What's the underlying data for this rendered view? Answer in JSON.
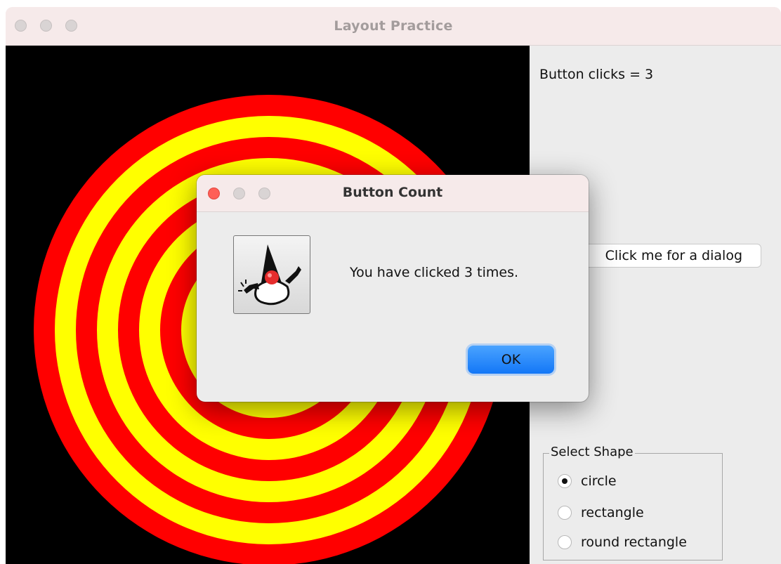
{
  "window": {
    "title": "Layout Practice"
  },
  "canvas": {
    "background": "#000000",
    "ring_colors": [
      "#ff0000",
      "#ffff00"
    ]
  },
  "side_panel": {
    "clicks_text": "Button clicks = 3",
    "dialog_button_label": "Click me for a dialog",
    "shape_group": {
      "title": "Select Shape",
      "options": [
        {
          "label": "circle",
          "checked": true
        },
        {
          "label": "rectangle",
          "checked": false
        },
        {
          "label": "round rectangle",
          "checked": false
        }
      ]
    }
  },
  "dialog": {
    "title": "Button Count",
    "message": "You have clicked 3 times.",
    "ok_label": "OK",
    "icon": "java-duke-icon",
    "accent": "#1377f7"
  }
}
